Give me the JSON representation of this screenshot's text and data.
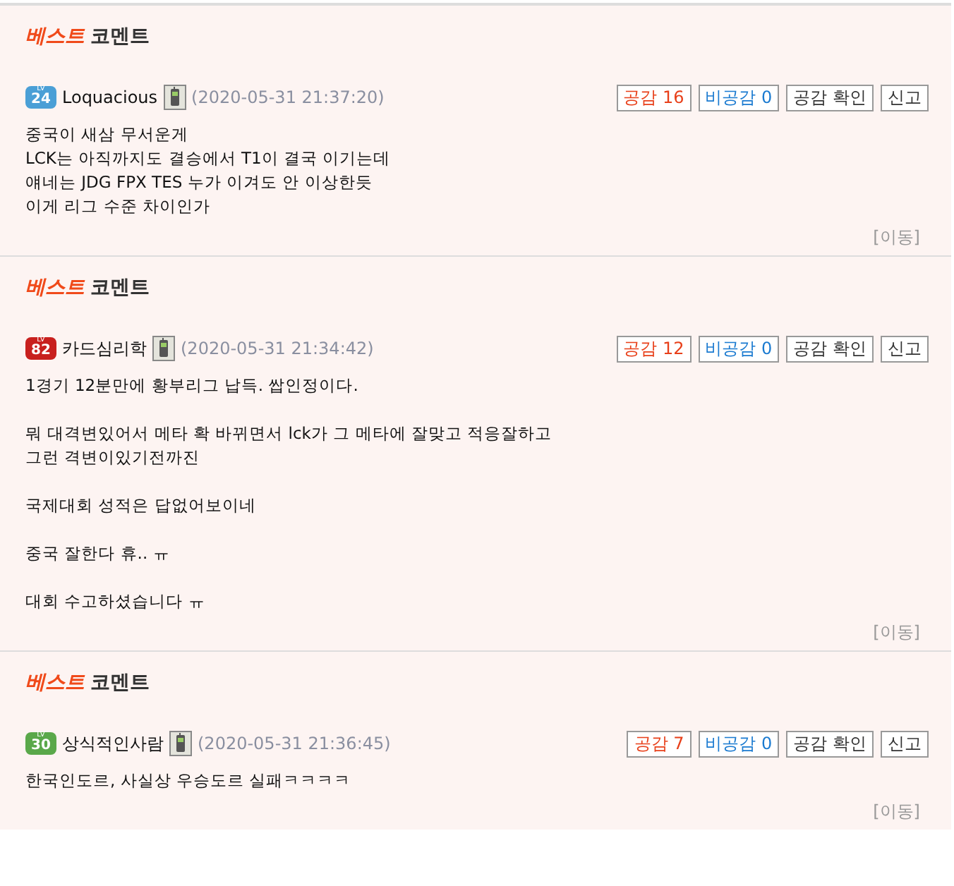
{
  "comments": [
    {
      "header": {
        "accent": "베스트",
        "rest": "코멘트"
      },
      "level_label": "LV",
      "level": "24",
      "color": "#4a9fd6",
      "author": "Loquacious",
      "date": "(2020-05-31 21:37:20)",
      "agree": "공감 16",
      "disagree": "비공감 0",
      "check": "공감 확인",
      "report": "신고",
      "paragraphs": [
        [
          "중국이 새삼 무서운게",
          "LCK는 아직까지도 결승에서 T1이 결국 이기는데",
          "얘네는 JDG FPX TES 누가 이겨도 안 이상한듯",
          "이게 리그 수준 차이인가"
        ]
      ],
      "move": "[이동]"
    },
    {
      "header": {
        "accent": "베스트",
        "rest": "코멘트"
      },
      "level_label": "LV",
      "level": "82",
      "color": "#c8201e",
      "author": "카드심리학",
      "date": "(2020-05-31 21:34:42)",
      "agree": "공감 12",
      "disagree": "비공감 0",
      "check": "공감 확인",
      "report": "신고",
      "paragraphs": [
        [
          "1경기 12분만에 황부리그 납득. 쌉인정이다."
        ],
        [
          "뭐 대격변있어서 메타 확 바뀌면서 lck가 그 메타에 잘맞고 적응잘하고",
          "그런 격변이있기전까진"
        ],
        [
          "국제대회 성적은 답없어보이네"
        ],
        [
          "중국 잘한다 휴.. ㅠ"
        ],
        [
          "대회 수고하셨습니다 ㅠ"
        ]
      ],
      "move": "[이동]"
    },
    {
      "header": {
        "accent": "베스트",
        "rest": "코멘트"
      },
      "level_label": "LV",
      "level": "30",
      "color": "#5aa84a",
      "author": "상식적인사람",
      "date": "(2020-05-31 21:36:45)",
      "agree": "공감 7",
      "disagree": "비공감 0",
      "check": "공감 확인",
      "report": "신고",
      "paragraphs": [
        [
          "한국인도르, 사실상 우승도르 실패ㅋㅋㅋㅋ"
        ]
      ],
      "move": "[이동]"
    }
  ]
}
